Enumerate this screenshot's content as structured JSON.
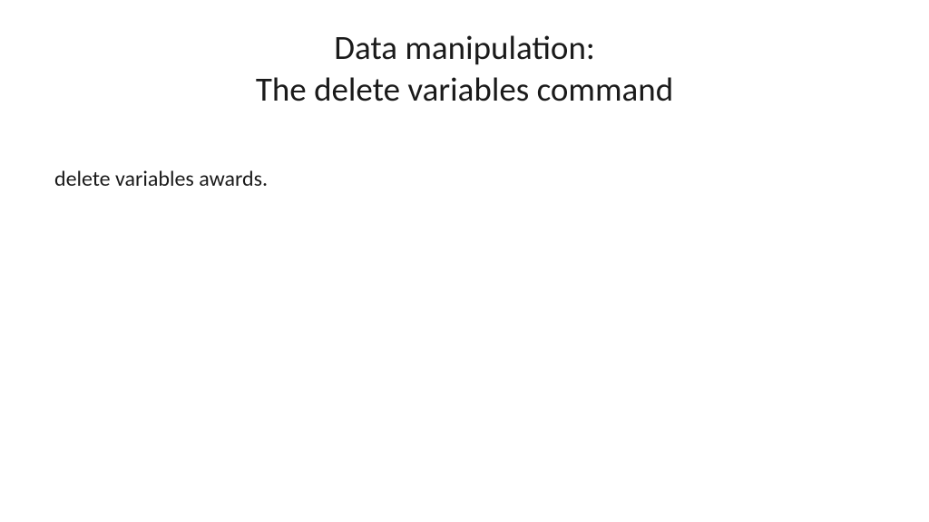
{
  "slide": {
    "title_line1": "Data manipulation:",
    "title_line2": "The delete variables command",
    "body": "delete variables awards."
  }
}
